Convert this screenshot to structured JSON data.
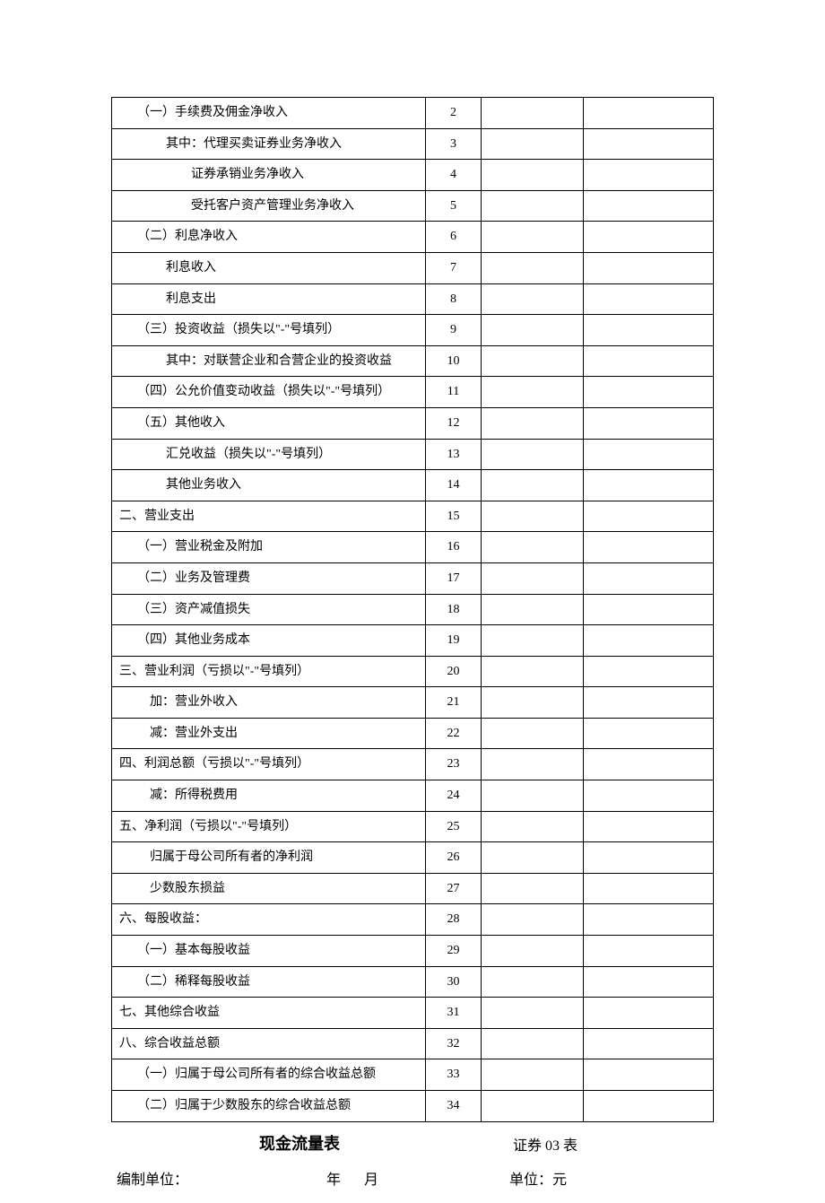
{
  "rows": [
    {
      "label": "（一）手续费及佣金净收入",
      "num": "2",
      "indent": 1
    },
    {
      "label": "其中：代理买卖证券业务净收入",
      "num": "3",
      "indent": 2
    },
    {
      "label": "证券承销业务净收入",
      "num": "4",
      "indent": 3
    },
    {
      "label": "受托客户资产管理业务净收入",
      "num": "5",
      "indent": 3
    },
    {
      "label": "（二）利息净收入",
      "num": "6",
      "indent": 1
    },
    {
      "label": "利息收入",
      "num": "7",
      "indent": 2
    },
    {
      "label": "利息支出",
      "num": "8",
      "indent": 2
    },
    {
      "label": "（三）投资收益（损失以\"-\"号填列）",
      "num": "9",
      "indent": 1
    },
    {
      "label": "其中：对联营企业和合营企业的投资收益",
      "num": "10",
      "indent": 2
    },
    {
      "label": "（四）公允价值变动收益（损失以\"-\"号填列）",
      "num": "11",
      "indent": 1
    },
    {
      "label": "（五）其他收入",
      "num": "12",
      "indent": 1
    },
    {
      "label": "汇兑收益（损失以\"-\"号填列）",
      "num": "13",
      "indent": 2
    },
    {
      "label": "其他业务收入",
      "num": "14",
      "indent": 2
    },
    {
      "label": "二、营业支出",
      "num": "15",
      "indent": 0
    },
    {
      "label": "（一）营业税金及附加",
      "num": "16",
      "indent": 1
    },
    {
      "label": "（二）业务及管理费",
      "num": "17",
      "indent": 1
    },
    {
      "label": "（三）资产减值损失",
      "num": "18",
      "indent": 1
    },
    {
      "label": "（四）其他业务成本",
      "num": "19",
      "indent": 1
    },
    {
      "label": "三、营业利润（亏损以\"-\"号填列）",
      "num": "20",
      "indent": 0
    },
    {
      "label": "加：营业外收入",
      "num": "21",
      "indent": 1,
      "extraIndent": true
    },
    {
      "label": "减：营业外支出",
      "num": "22",
      "indent": 1,
      "extraIndent": true
    },
    {
      "label": "四、利润总额（亏损以\"-\"号填列）",
      "num": "23",
      "indent": 0
    },
    {
      "label": "减：所得税费用",
      "num": "24",
      "indent": 1,
      "extraIndent": true
    },
    {
      "label": "五、净利润（亏损以\"-\"号填列）",
      "num": "25",
      "indent": 0
    },
    {
      "label": "归属于母公司所有者的净利润",
      "num": "26",
      "indent": 1,
      "extraIndent": true
    },
    {
      "label": "少数股东损益",
      "num": "27",
      "indent": 1,
      "extraIndent": true
    },
    {
      "label": "六、每股收益：",
      "num": "28",
      "indent": 0
    },
    {
      "label": "（一）基本每股收益",
      "num": "29",
      "indent": 1
    },
    {
      "label": "（二）稀释每股收益",
      "num": "30",
      "indent": 1
    },
    {
      "label": "七、其他综合收益",
      "num": "31",
      "indent": 0
    },
    {
      "label": "八、综合收益总额",
      "num": "32",
      "indent": 0
    },
    {
      "label": "（一）归属于母公司所有者的综合收益总额",
      "num": "33",
      "indent": 1
    },
    {
      "label": "（二）归属于少数股东的综合收益总额",
      "num": "34",
      "indent": 1
    }
  ],
  "footer": {
    "title": "现金流量表",
    "formCode": "证券 03 表",
    "compiler": "编制单位：",
    "dateYear": "年",
    "dateMonth": "月",
    "unit": "单位：元"
  }
}
